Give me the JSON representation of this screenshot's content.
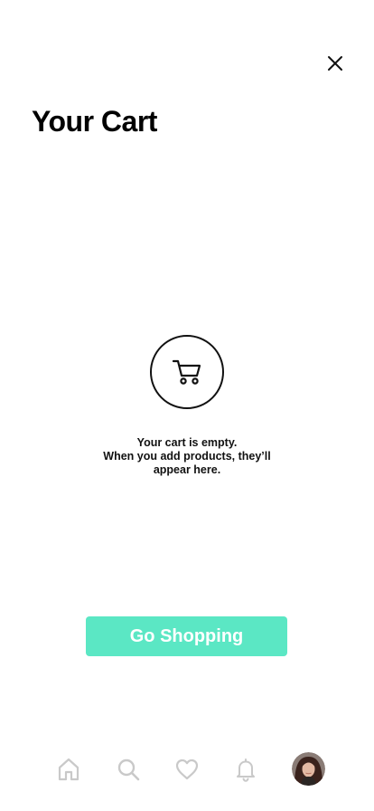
{
  "header": {
    "title": "Your Cart",
    "close_icon": "close-icon"
  },
  "empty_state": {
    "icon": "shopping-cart-icon",
    "line1": "Your cart is empty.",
    "line2": "When you add products, they’ll",
    "line3": "appear here."
  },
  "cta": {
    "label": "Go Shopping",
    "color": "#5be7c4"
  },
  "tabbar": {
    "items": [
      {
        "icon": "home-icon"
      },
      {
        "icon": "search-icon"
      },
      {
        "icon": "heart-icon"
      },
      {
        "icon": "bell-icon"
      },
      {
        "icon": "profile-avatar"
      }
    ],
    "inactive_color": "#c9c9c9"
  }
}
